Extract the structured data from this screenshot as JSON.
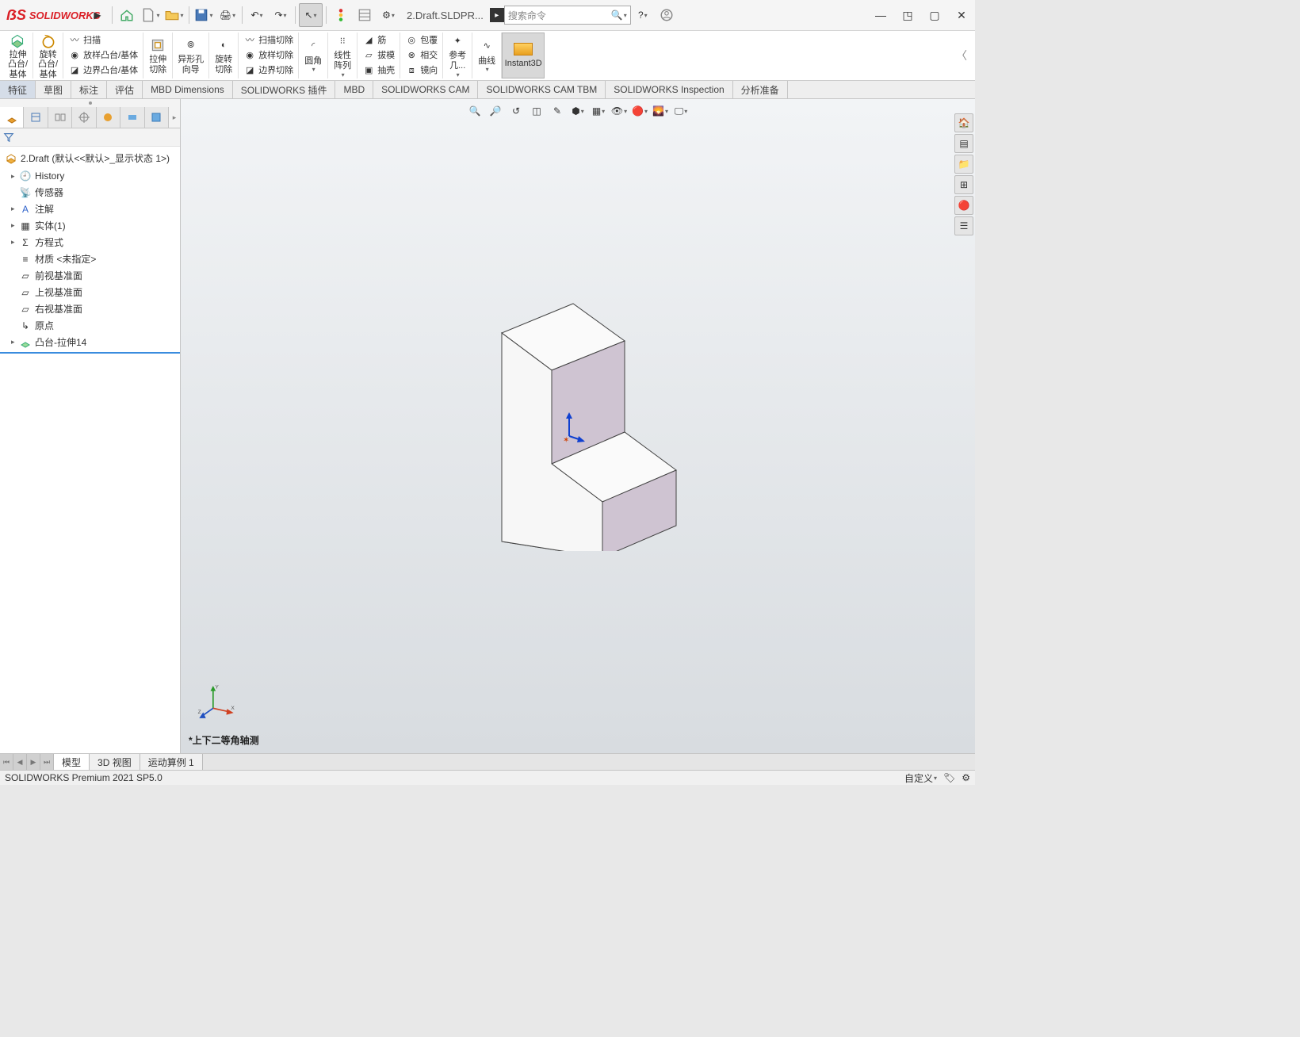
{
  "app": {
    "brand": "SOLIDWORKS"
  },
  "title_doc": "2.Draft.SLDPR...",
  "search_placeholder": "搜索命令",
  "ribbon": {
    "extrude_boss": "拉伸\n凸台/\n基体",
    "revolve_boss": "旋转\n凸台/\n基体",
    "sweep": "扫描",
    "loft_boss": "放样凸台/基体",
    "boundary_boss": "边界凸台/基体",
    "extrude_cut": "拉伸\n切除",
    "hole_wiz": "异形孔\n向导",
    "revolve_cut": "旋转\n切除",
    "sweep_cut": "扫描切除",
    "loft_cut": "放样切除",
    "boundary_cut": "边界切除",
    "fillet": "圆角",
    "lpattern": "线性\n阵列",
    "rib": "筋",
    "draft": "拔模",
    "shell": "抽壳",
    "wrap": "包覆",
    "intersect": "相交",
    "mirror": "镜向",
    "ref_geom": "参考\n几...",
    "curves": "曲线",
    "instant3d": "Instant3D"
  },
  "tabs": {
    "feature": "特征",
    "sketch": "草图",
    "annotate": "标注",
    "evaluate": "评估",
    "mbd_dim": "MBD Dimensions",
    "sw_addins": "SOLIDWORKS 插件",
    "mbd": "MBD",
    "sw_cam": "SOLIDWORKS CAM",
    "sw_cam_tbm": "SOLIDWORKS CAM TBM",
    "sw_inspect": "SOLIDWORKS Inspection",
    "analysis_prep": "分析准备"
  },
  "tree": {
    "root": "2.Draft  (默认<<默认>_显示状态 1>)",
    "history": "History",
    "sensors": "传感器",
    "annotations": "注解",
    "solid_bodies": "实体(1)",
    "equations": "方程式",
    "material": "材质 <未指定>",
    "front_plane": "前视基准面",
    "top_plane": "上视基准面",
    "right_plane": "右视基准面",
    "origin": "原点",
    "boss_extrude": "凸台-拉伸14"
  },
  "orientation_label": "*上下二等角轴测",
  "bottom_tabs": {
    "model": "模型",
    "view3d": "3D 视图",
    "motion1": "运动算例 1"
  },
  "status": {
    "product": "SOLIDWORKS Premium 2021 SP5.0",
    "custom": "自定义"
  }
}
